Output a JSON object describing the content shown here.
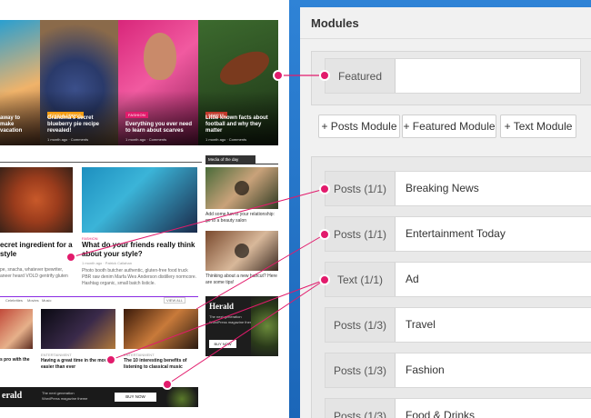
{
  "panel": {
    "title": "Modules",
    "featured_label": "Featured",
    "buttons": [
      "+ Posts Module",
      "+ Featured Module",
      "+ Text Module"
    ],
    "rows": [
      {
        "type": "Posts (1/1)",
        "name": "Breaking News"
      },
      {
        "type": "Posts (1/1)",
        "name": "Entertainment Today"
      },
      {
        "type": "Text (1/1)",
        "name": "Ad"
      },
      {
        "type": "Posts (1/3)",
        "name": "Travel"
      },
      {
        "type": "Posts (1/3)",
        "name": "Fashion"
      },
      {
        "type": "Posts (1/3)",
        "name": "Food & Drinks"
      }
    ]
  },
  "preview": {
    "cards": [
      {
        "tag": "",
        "title": "away to make vacation",
        "meta": ""
      },
      {
        "tag": "FOOD & DRINKS",
        "title": "Grandma's secret blueberry pie recipe revealed!",
        "meta": "1 month ago  ·  Comments"
      },
      {
        "tag": "FASHION",
        "title": "Everything you ever need to learn about scarves",
        "meta": "1 month ago  ·  Comments"
      },
      {
        "tag": "SPORTS",
        "title": "Little known facts about football and why they matter",
        "meta": "1 month ago  ·  Comments"
      }
    ],
    "post1_title": "ecret ingredient for a",
    "post1_title2": "style",
    "post1_text": "pe, snacha, whatever tpewriter, aneer heard VOLD gentrify gluten",
    "post2_tag": "FASHION",
    "post2_title": "What do your friends really think about your style?",
    "post2_meta": "1 month ago  ·  Patrick Callahan",
    "post2_text": "Photo booth butcher authentic, gluten-free food truck PBR raw denim Marfa Wes Anderson distillery normcore. Hashtag organic, small batch listicle.",
    "sidebar_title": "Media of the day",
    "side1": "Add some fun to your relationship: go to a beauty salon",
    "side2": "Thinking about a new haircut? Here are some tips!",
    "tabs": [
      "Celebrities",
      "Movies",
      "Music"
    ],
    "viewall": "VIEW ALL",
    "small1": "Having a great time in the movie easier than ever",
    "small2": "The 10 interesting benefits of listening to classical music",
    "small0": "s pro with the",
    "small_tag1": "ENTERTAINMENT",
    "small_tag2": "ENTERTAINMENT",
    "ad_brand": "Herald",
    "ad_line1": "The next generation",
    "ad_line2": "WordPress magazine theme",
    "ad_button": "BUY NOW",
    "ad_brand2": "erald",
    "bottom_button": "BUY NOW"
  }
}
